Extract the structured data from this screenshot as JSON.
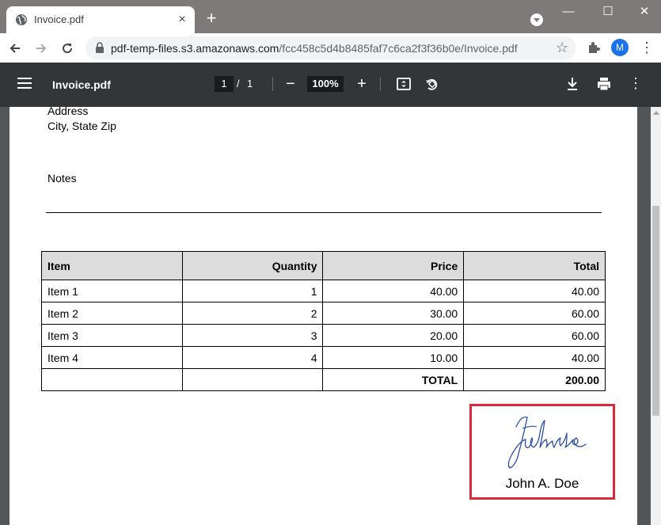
{
  "browser": {
    "tab": {
      "title": "Invoice.pdf",
      "favicon": "globe-icon",
      "close": "×"
    },
    "new_tab": "+",
    "window_controls": {
      "minimize": "—",
      "maximize": "☐",
      "close": "✕"
    },
    "address": {
      "url_host": "pdf-temp-files.s3.amazonaws.com",
      "url_path": "/fcc458c5d4b8485faf7c6ca2f3f36b0e/Invoice.pdf"
    },
    "avatar_initial": "M"
  },
  "viewer": {
    "title": "Invoice.pdf",
    "current_page": "1",
    "page_separator": "/",
    "total_pages": "1",
    "zoom": "100%",
    "zoom_out": "−",
    "zoom_in": "+"
  },
  "document": {
    "address_lines": [
      "Address",
      "City, State Zip"
    ],
    "notes_label": "Notes",
    "table": {
      "headers": [
        "Item",
        "Quantity",
        "Price",
        "Total"
      ],
      "rows": [
        [
          "Item 1",
          "1",
          "40.00",
          "40.00"
        ],
        [
          "Item 2",
          "2",
          "30.00",
          "60.00"
        ],
        [
          "Item 3",
          "3",
          "20.00",
          "60.00"
        ],
        [
          "Item 4",
          "4",
          "10.00",
          "40.00"
        ]
      ],
      "total_label": "TOTAL",
      "total_value": "200.00"
    },
    "signature_name": "John A. Doe"
  },
  "colors": {
    "tabstrip": "#7f7a7a",
    "viewer_toolbar": "#323639",
    "highlight_border": "#d92b39",
    "signature_ink": "#2c4fa8"
  }
}
